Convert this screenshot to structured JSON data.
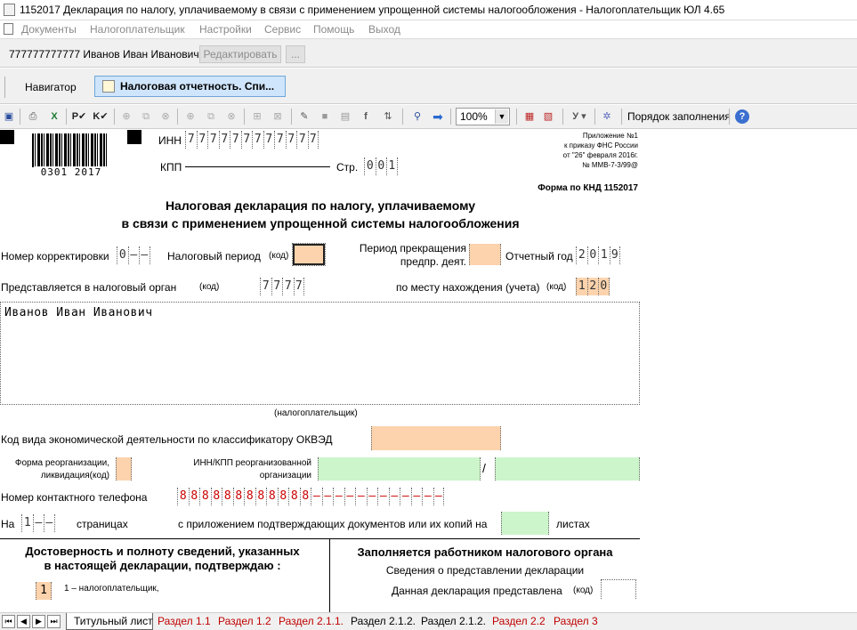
{
  "window": {
    "title": "1152017 Декларация по налогу, уплачиваемому в связи с применением упрощенной системы налогообложения - Налогоплательщик ЮЛ 4.65"
  },
  "menu": {
    "items": [
      "Документы",
      "Налогоплательщик",
      "Настройки",
      "Сервис",
      "Помощь",
      "Выход"
    ]
  },
  "userbar": {
    "taxpayer": "777777777777 Иванов Иван Иванович",
    "edit_label": "Редактировать",
    "more_label": "..."
  },
  "tabs": {
    "navigator": "Навигатор",
    "document": "Налоговая отчетность. Спи..."
  },
  "toolbar": {
    "zoom": "100%",
    "fill_order": "Порядок заполнения"
  },
  "form": {
    "barcode_number": "0301 2017",
    "inn_label": "ИНН",
    "inn_digits": [
      "7",
      "7",
      "7",
      "7",
      "7",
      "7",
      "7",
      "7",
      "7",
      "7",
      "7",
      "7"
    ],
    "kpp_label": "КПП",
    "page_label": "Стр.",
    "page_digits": [
      "0",
      "0",
      "1"
    ],
    "appendix": [
      "Приложение №1",
      "к приказу ФНС России",
      "от \"26\" февраля 2016г.",
      "№ ММВ-7-3/99@"
    ],
    "knd": "Форма по КНД 1152017",
    "title_line1": "Налоговая декларация по налогу, уплачиваемому",
    "title_line2": "в связи с применением упрощенной системы налогообложения",
    "correction_label": "Номер корректировки",
    "correction_digits": [
      "0",
      "–",
      "–"
    ],
    "tax_period_label": "Налоговый период",
    "code_label": "(код)",
    "termination_label1": "Период прекращения",
    "termination_label2": "предпр. деят.",
    "report_year_label": "Отчетный год",
    "report_year_digits": [
      "2",
      "0",
      "1",
      "9"
    ],
    "tax_authority_label": "Представляется в налоговый орган",
    "tax_authority_digits": [
      "7",
      "7",
      "7",
      "7"
    ],
    "location_label": "по месту нахождения (учета)",
    "location_digits": [
      "1",
      "2",
      "0"
    ],
    "taxpayer_name": "Иванов Иван Иванович",
    "taxpayer_caption": "(налогоплательщик)",
    "okved_label": "Код вида экономической деятельности по классификатору ОКВЭД",
    "reorg_label1": "Форма реорганизации,",
    "reorg_label2": "ликвидация(код)",
    "reorg_inn_label1": "ИНН/КПП реорганизованной",
    "reorg_inn_label2": "организации",
    "slash": "/",
    "phone_label": "Номер контактного телефона",
    "phone_digits": [
      "8",
      "8",
      "8",
      "8",
      "8",
      "8",
      "8",
      "8",
      "8",
      "8",
      "8",
      "8",
      "–",
      "–",
      "–",
      "–",
      "–",
      "–",
      "–",
      "–",
      "–",
      "–",
      "–",
      "–"
    ],
    "pages_prefix": "На",
    "pages_digits": [
      "1",
      "–",
      "–"
    ],
    "pages_suffix": "страницах",
    "attach_label": "с приложением подтверждающих документов или их копий на",
    "sheets_label": "листах",
    "confirm_title1": "Достоверность и полноту сведений, указанных",
    "confirm_title2": "в настоящей декларации, подтверждаю :",
    "confirm_value": "1",
    "confirm_option": "1 – налогоплательщик,",
    "inspector_title": "Заполняется работником налогового органа",
    "inspector_sub": "Сведения о представлении декларации",
    "inspector_presented": "Данная декларация представлена"
  },
  "sheet_tabs": [
    {
      "label": "Титульный лист",
      "active": true
    },
    {
      "label": "Раздел 1.1",
      "active": false
    },
    {
      "label": "Раздел 1.2",
      "active": false
    },
    {
      "label": "Раздел 2.1.1.",
      "active": false
    },
    {
      "label": "Раздел 2.1.2.",
      "active": false
    },
    {
      "label": "Раздел 2.1.2.",
      "active": false
    },
    {
      "label": "Раздел 2.2",
      "active": false
    },
    {
      "label": "Раздел 3",
      "active": false
    }
  ],
  "colors": {
    "required_field": "#fcd3ad",
    "optional_field": "#cdf5cb",
    "active_tab": "#cfe5fb",
    "sheet_tab_text": "#c00000"
  }
}
